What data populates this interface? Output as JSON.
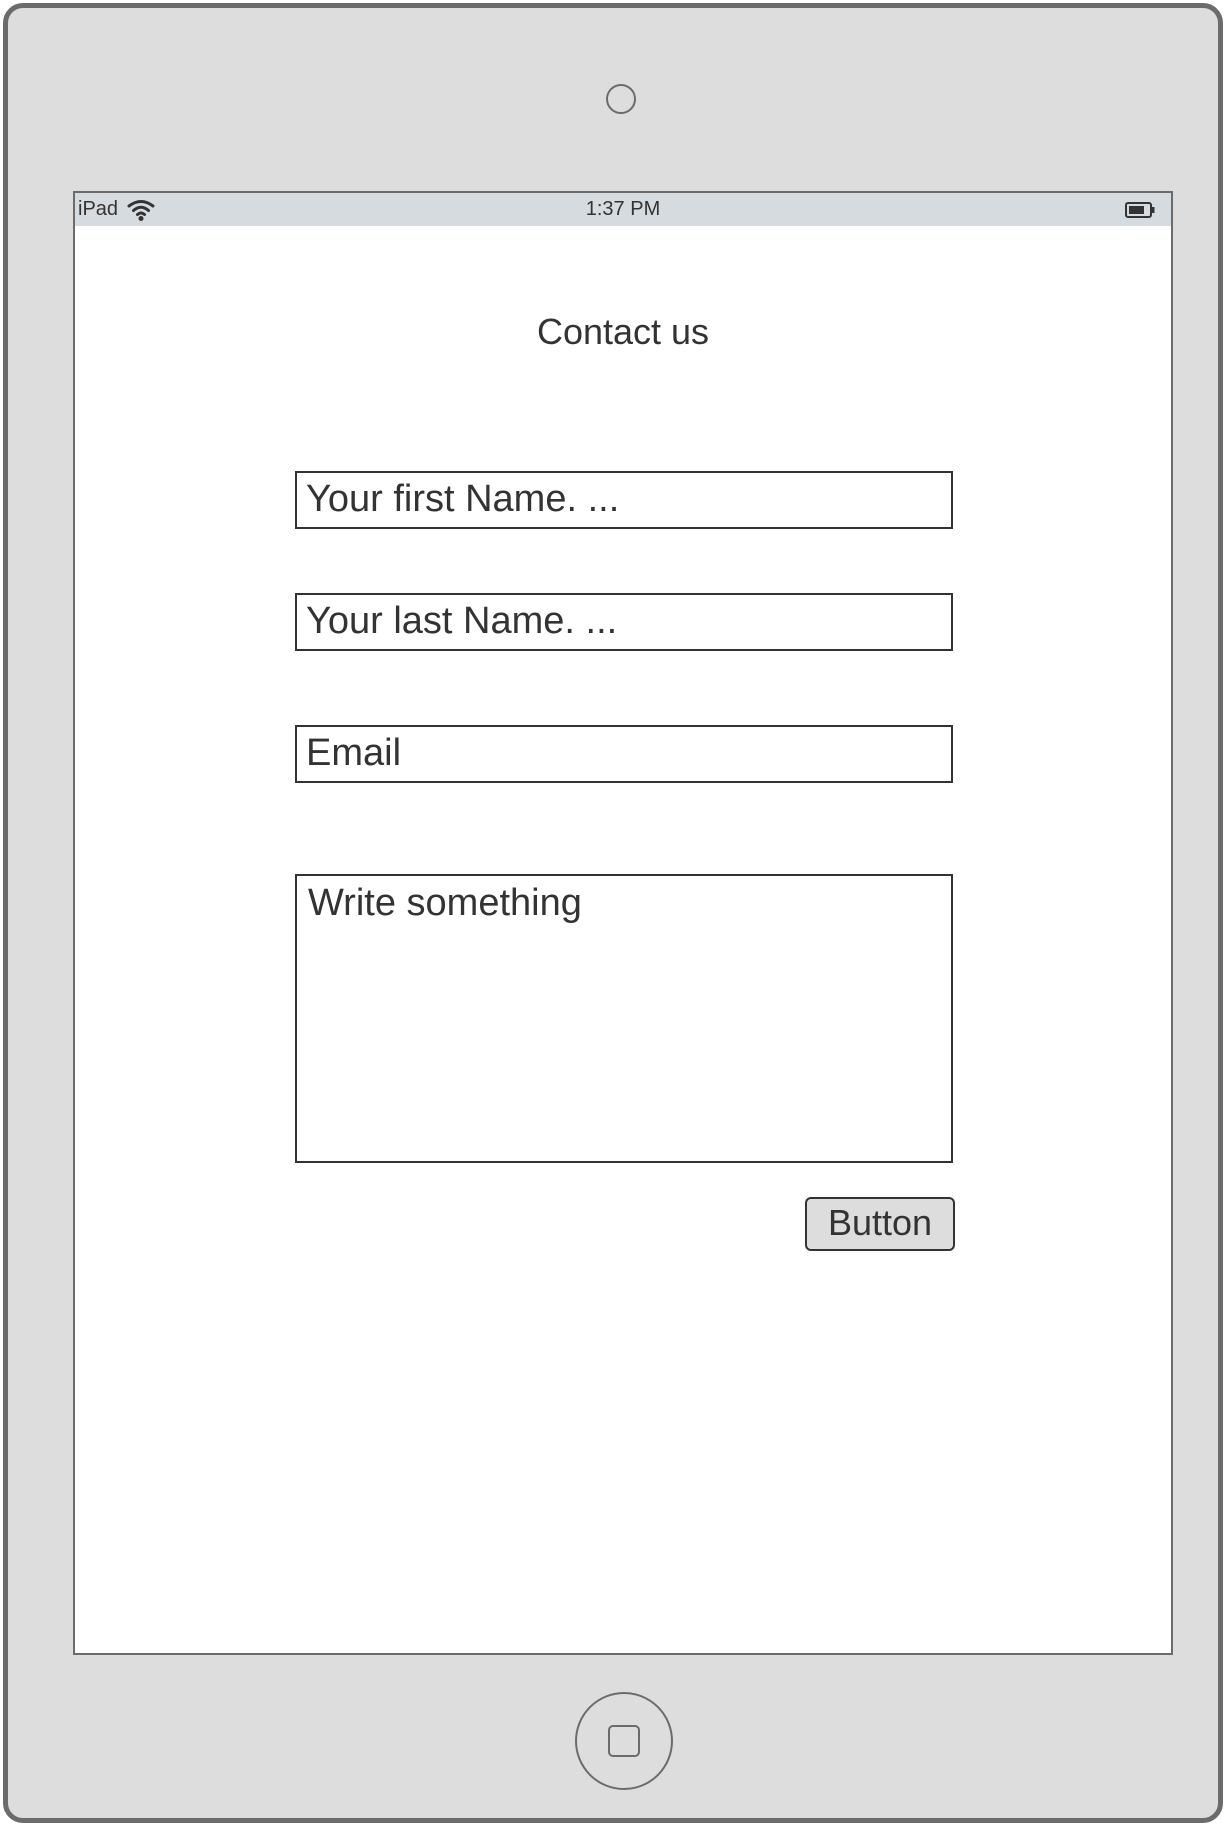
{
  "status_bar": {
    "device_label": "iPad",
    "wifi_icon": "wifi-icon",
    "time": "1:37 PM",
    "battery_icon": "battery-icon"
  },
  "form": {
    "title": "Contact us",
    "first_name_placeholder": "Your first Name. ...",
    "last_name_placeholder": "Your last Name. ...",
    "email_placeholder": "Email",
    "message_placeholder": "Write something",
    "submit_label": "Button"
  },
  "device": {
    "camera_icon": "camera-icon",
    "home_button_icon": "home-button-icon"
  },
  "colors": {
    "device_frame": "#dddddd",
    "device_border": "#6b6b6b",
    "status_bar": "#d6dbdf",
    "text": "#333333",
    "screen": "#ffffff",
    "button": "#dddddd"
  }
}
